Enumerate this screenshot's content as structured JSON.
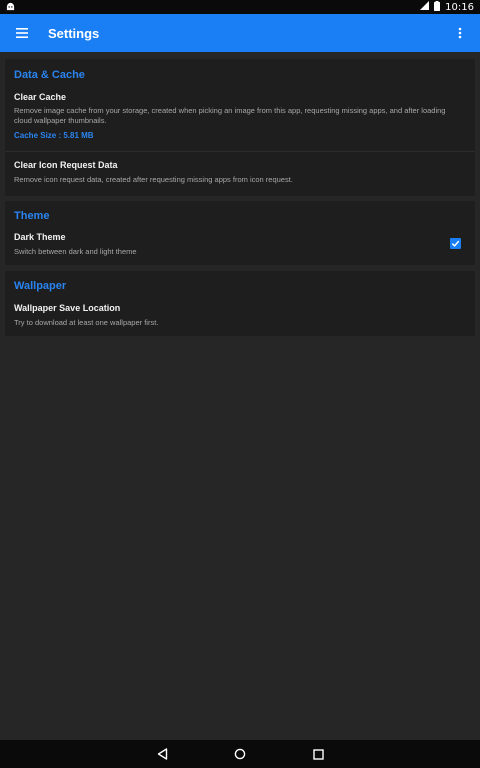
{
  "status_bar": {
    "time": "10:16",
    "icons": [
      "android-notification-icon",
      "signal-icon",
      "battery-icon"
    ]
  },
  "app_bar": {
    "title": "Settings",
    "menu_icon": "menu-icon",
    "overflow_icon": "more-vert-icon",
    "color": "#1a7ff5"
  },
  "sections": {
    "data_cache": {
      "title": "Data & Cache",
      "clear_cache": {
        "title": "Clear Cache",
        "summary": "Remove image cache from your storage, created when picking an image from this app, requesting missing apps, and after loading cloud wallpaper thumbnails.",
        "cache_size": "Cache Size : 5.81 MB"
      },
      "clear_icon_request": {
        "title": "Clear Icon Request Data",
        "summary": "Remove icon request data, created after requesting missing apps from icon request."
      }
    },
    "theme": {
      "title": "Theme",
      "dark_theme": {
        "title": "Dark Theme",
        "summary": "Switch between dark and light theme",
        "checked": true
      }
    },
    "wallpaper": {
      "title": "Wallpaper",
      "save_location": {
        "title": "Wallpaper Save Location",
        "summary": "Try to download at least one wallpaper first."
      }
    }
  },
  "nav_bar": {
    "icons": [
      "back-icon",
      "home-icon",
      "recents-icon"
    ]
  },
  "colors": {
    "accent": "#2a84f0",
    "background": "#262626",
    "card": "#1e1e1e"
  }
}
